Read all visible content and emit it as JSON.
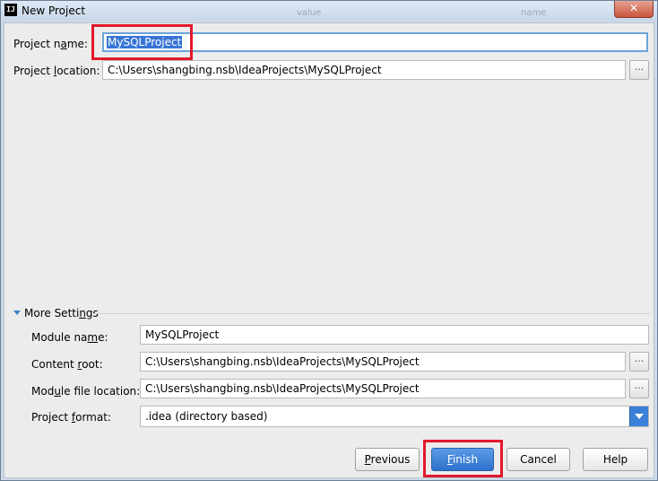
{
  "window": {
    "title": "New Project",
    "icon_text": "IJ",
    "close_glyph": "✕",
    "background_ghost": [
      "value",
      "name"
    ]
  },
  "form": {
    "project_name_label": "Project name:",
    "project_name_value": "MySQLProject",
    "project_location_label": "Project location:",
    "project_location_value": "C:\\Users\\shangbing.nsb\\IdeaProjects\\MySQLProject",
    "browse_label": "..."
  },
  "more_settings": {
    "header": "More Settings",
    "module_name_label": "Module name:",
    "module_name_value": "MySQLProject",
    "content_root_label": "Content root:",
    "content_root_value": "C:\\Users\\shangbing.nsb\\IdeaProjects\\MySQLProject",
    "module_file_location_label": "Module file location:",
    "module_file_location_value": "C:\\Users\\shangbing.nsb\\IdeaProjects\\MySQLProject",
    "project_format_label": "Project format:",
    "project_format_value": ".idea (directory based)"
  },
  "buttons": {
    "previous": "Previous",
    "finish": "Finish",
    "cancel": "Cancel",
    "help": "Help"
  },
  "colors": {
    "highlight": "#e2192b",
    "accent": "#3b7fd8",
    "selection": "#3875d7"
  }
}
